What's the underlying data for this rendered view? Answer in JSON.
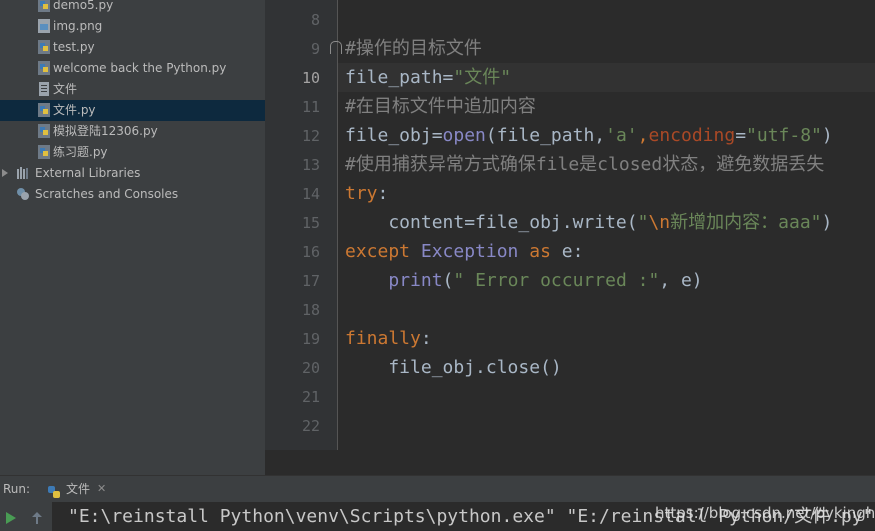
{
  "project_tree": {
    "items": [
      {
        "label": "demo5.py",
        "icon": "python-file-icon"
      },
      {
        "label": "img.png",
        "icon": "image-file-icon"
      },
      {
        "label": "test.py",
        "icon": "python-file-icon"
      },
      {
        "label": "welcome back the Python.py",
        "icon": "python-file-icon"
      },
      {
        "label": "文件",
        "icon": "text-file-icon"
      },
      {
        "label": "文件.py",
        "icon": "python-file-icon",
        "selected": true
      },
      {
        "label": "模拟登陆12306.py",
        "icon": "python-file-icon"
      },
      {
        "label": "练习题.py",
        "icon": "python-file-icon"
      },
      {
        "label": "External Libraries",
        "icon": "libraries-icon"
      },
      {
        "label": "Scratches and Consoles",
        "icon": "scratches-icon"
      }
    ]
  },
  "editor": {
    "line_numbers": [
      "8",
      "9",
      "10",
      "11",
      "12",
      "13",
      "14",
      "15",
      "16",
      "17",
      "18",
      "19",
      "20",
      "21",
      "22"
    ],
    "current_line": "10",
    "code": {
      "l9": "#操作的目标文件",
      "l10_var": "file_path=",
      "l10_str": "\"文件\"",
      "l11": "#在目标文件中追加内容",
      "l12_a": "file_obj=",
      "l12_open": "open",
      "l12_b": "(file_path,",
      "l12_mode": "'a'",
      "l12_c": ",",
      "l12_kw": "encoding",
      "l12_d": "=",
      "l12_enc": "\"utf-8\"",
      "l12_e": ")",
      "l13": "#使用捕获异常方式确保file是closed状态，避免数据丢失",
      "l14_try": "try",
      "l14_colon": ":",
      "l15_a": "    content=file_obj.write(",
      "l15_q": "\"",
      "l15_esc": "\\n",
      "l15_str": "新增加内容：aaa\"",
      "l15_b": ")",
      "l16_except": "except ",
      "l16_exc": "Exception",
      "l16_as": " as ",
      "l16_e": "e:",
      "l17_indent": "    ",
      "l17_print": "print",
      "l17_a": "(",
      "l17_str": "\" Error occurred :\"",
      "l17_b": ", e)",
      "l19_finally": "finally",
      "l19_colon": ":",
      "l20": "    file_obj.close()"
    }
  },
  "run": {
    "label": "Run:",
    "tab_label": "文件",
    "console_text": "\"E:\\reinstall Python\\venv\\Scripts\\python.exe\" \"E:/reinstall Python/文件.py\""
  },
  "watermark": "https://blog.csdn.net/pykinghu",
  "colors": {
    "keyword": "#cc7832",
    "string": "#6a8759",
    "comment": "#808080",
    "builtin": "#8888c6",
    "selection": "#0d293e",
    "run_green": "#499c54"
  }
}
